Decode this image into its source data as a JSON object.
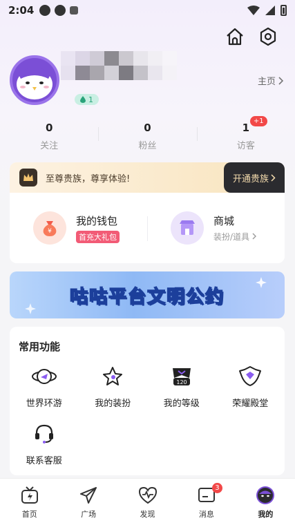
{
  "status_bar": {
    "time": "2:04"
  },
  "profile": {
    "homepage_label": "主页",
    "level": "1",
    "stats": [
      {
        "value": "0",
        "label": "关注"
      },
      {
        "value": "0",
        "label": "粉丝"
      },
      {
        "value": "1",
        "label": "访客",
        "badge": "+1"
      }
    ]
  },
  "vip": {
    "promo_text": "至尊贵族，尊享体验!",
    "button_label": "开通贵族",
    "wallet_title": "我的钱包",
    "wallet_tag": "首充大礼包",
    "store_title": "商城",
    "store_sub": "装扮/道具"
  },
  "banner": {
    "text": "咕咕平台文明公约"
  },
  "functions": {
    "title": "常用功能",
    "items": [
      {
        "label": "世界环游",
        "icon": "planet-plane-icon"
      },
      {
        "label": "我的装扮",
        "icon": "star-outfit-icon"
      },
      {
        "label": "我的等级",
        "icon": "level-120-icon"
      },
      {
        "label": "荣耀殿堂",
        "icon": "shield-crown-icon"
      },
      {
        "label": "联系客服",
        "icon": "headset-icon"
      }
    ]
  },
  "tabbar": {
    "items": [
      {
        "label": "首页",
        "icon": "home-tv-icon"
      },
      {
        "label": "广场",
        "icon": "paper-plane-icon"
      },
      {
        "label": "发现",
        "icon": "heart-pulse-icon"
      },
      {
        "label": "消息",
        "icon": "message-icon",
        "badge": "3"
      },
      {
        "label": "我的",
        "icon": "avatar-icon"
      }
    ]
  },
  "colors": {
    "accent": "#7b4fd6",
    "badge_red": "#f24848",
    "vip_dark": "#2b2b2f"
  }
}
